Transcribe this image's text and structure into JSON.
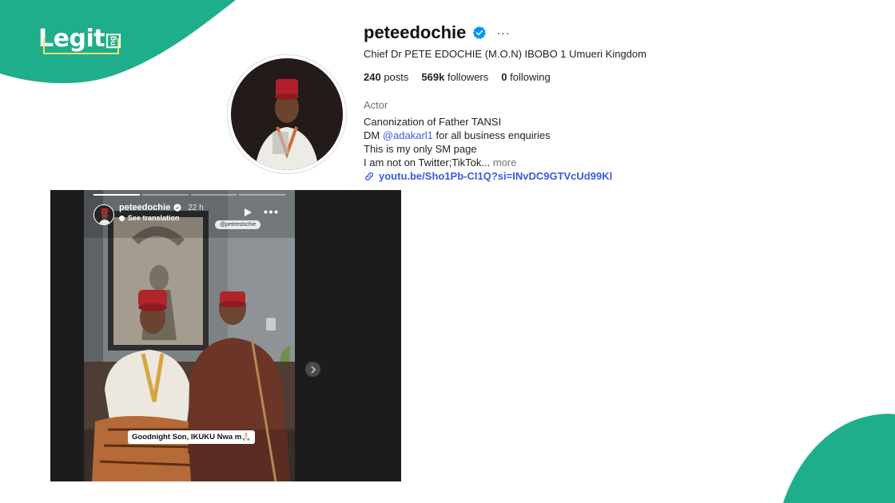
{
  "brand": {
    "logo_text": "Legit",
    "logo_suffix": "ng"
  },
  "colors": {
    "brand_green": "#1fae8b",
    "link_blue": "#3c5bd8",
    "verified_blue": "#0095f6"
  },
  "profile": {
    "username": "peteedochie",
    "verified_icon": "verified-badge-icon",
    "more_icon": "ellipsis-icon",
    "more_text": "···",
    "full_name": "Chief Dr PETE EDOCHIE (M.O.N) IBOBO 1 Umueri Kingdom",
    "stats": {
      "posts_count": "240",
      "posts_label": "posts",
      "followers_count": "569k",
      "followers_label": "followers",
      "following_count": "0",
      "following_label": "following"
    },
    "category": "Actor",
    "bio": {
      "line1": "Canonization of Father TANSI",
      "line2_prefix": "DM ",
      "line2_mention": "@adakarl1",
      "line2_suffix": " for all business enquiries",
      "line3": "This is my only SM page",
      "line4": "I am not on Twitter;TikTok...",
      "more": "more"
    },
    "link_icon": "link-icon",
    "link": "youtu.be/Sho1Pb-Cl1Q?si=INvDC9GTVcUd99Kl"
  },
  "story": {
    "username": "peteedochie",
    "time": "22 h",
    "see_translation": "See translation",
    "tag": "@peteedochie",
    "caption": "Goodnight Son, IKUKU Nwa m🙏🏻",
    "progress": [
      1,
      0,
      0,
      0
    ],
    "play_icon": "play-icon",
    "options_icon": "ellipsis-icon",
    "next_icon": "chevron-right-icon"
  }
}
